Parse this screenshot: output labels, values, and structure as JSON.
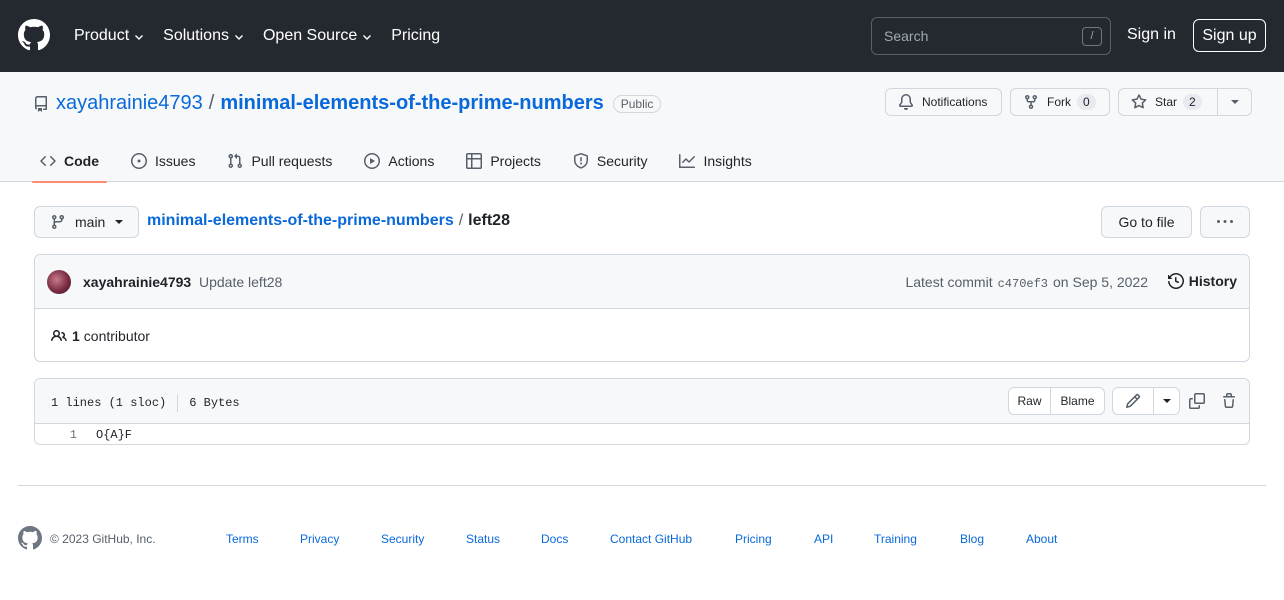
{
  "header": {
    "nav": [
      "Product",
      "Solutions",
      "Open Source",
      "Pricing"
    ],
    "search_placeholder": "Search",
    "search_shortcut": "/",
    "signin": "Sign in",
    "signup": "Sign up"
  },
  "repo": {
    "owner": "xayahrainie4793",
    "separator": "/",
    "name": "minimal-elements-of-the-prime-numbers",
    "visibility": "Public",
    "notifications_label": "Notifications",
    "fork_label": "Fork",
    "fork_count": "0",
    "star_label": "Star",
    "star_count": "2"
  },
  "tabs": [
    "Code",
    "Issues",
    "Pull requests",
    "Actions",
    "Projects",
    "Security",
    "Insights"
  ],
  "breadcrumb": {
    "branch": "main",
    "repo": "minimal-elements-of-the-prime-numbers",
    "separator": "/",
    "file": "left28",
    "go_to_file": "Go to file"
  },
  "commit": {
    "author": "xayahrainie4793",
    "message": "Update left28",
    "latest_label": "Latest commit",
    "sha": "c470ef3",
    "date": "on Sep 5, 2022",
    "history": "History",
    "contributors_count": "1",
    "contributors_label": "contributor"
  },
  "file": {
    "lines": "1 lines (1 sloc)",
    "size": "6 Bytes",
    "raw": "Raw",
    "blame": "Blame",
    "code_lines": [
      {
        "number": "1",
        "text": "O{A}F"
      }
    ]
  },
  "footer": {
    "copyright": "© 2023 GitHub, Inc.",
    "links": [
      "Terms",
      "Privacy",
      "Security",
      "Status",
      "Docs",
      "Contact GitHub",
      "Pricing",
      "API",
      "Training",
      "Blog",
      "About"
    ]
  },
  "colors": {
    "header_bg": "#24292f",
    "link": "#0969da",
    "active_tab_underline": "#fd8c73"
  }
}
